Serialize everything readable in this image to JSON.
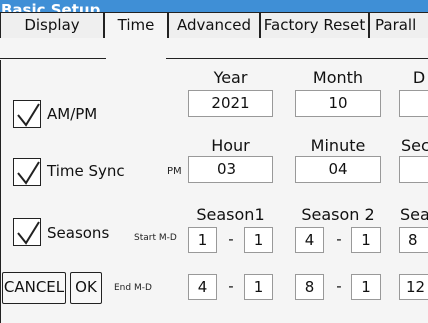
{
  "window": {
    "title": "Basic Setup"
  },
  "tabs": [
    {
      "label": "Display"
    },
    {
      "label": "Time"
    },
    {
      "label": "Advanced"
    },
    {
      "label": "Factory Reset"
    },
    {
      "label": "Parall"
    }
  ],
  "date": {
    "ampm_label": "AM/PM",
    "ampm_checked": true,
    "year_header": "Year",
    "month_header": "Month",
    "day_header": "D",
    "year": "2021",
    "month": "10",
    "day": ""
  },
  "time": {
    "sync_label": "Time Sync",
    "sync_checked": true,
    "pm_label": "PM",
    "hour_header": "Hour",
    "minute_header": "Minute",
    "second_header": "Sec",
    "hour": "03",
    "minute": "04",
    "second": ""
  },
  "seasons": {
    "label": "Seasons",
    "checked": true,
    "start_label": "Start M-D",
    "end_label": "End M-D",
    "headers": [
      "Season1",
      "Season 2",
      "Sea"
    ],
    "start": [
      {
        "m": "1",
        "d": "1"
      },
      {
        "m": "4",
        "d": "1"
      },
      {
        "m": "8",
        "d": ""
      }
    ],
    "end": [
      {
        "m": "4",
        "d": "1"
      },
      {
        "m": "8",
        "d": "1"
      },
      {
        "m": "12",
        "d": ""
      }
    ],
    "separator": "-"
  },
  "buttons": {
    "cancel": "CANCEL",
    "ok": "OK"
  }
}
